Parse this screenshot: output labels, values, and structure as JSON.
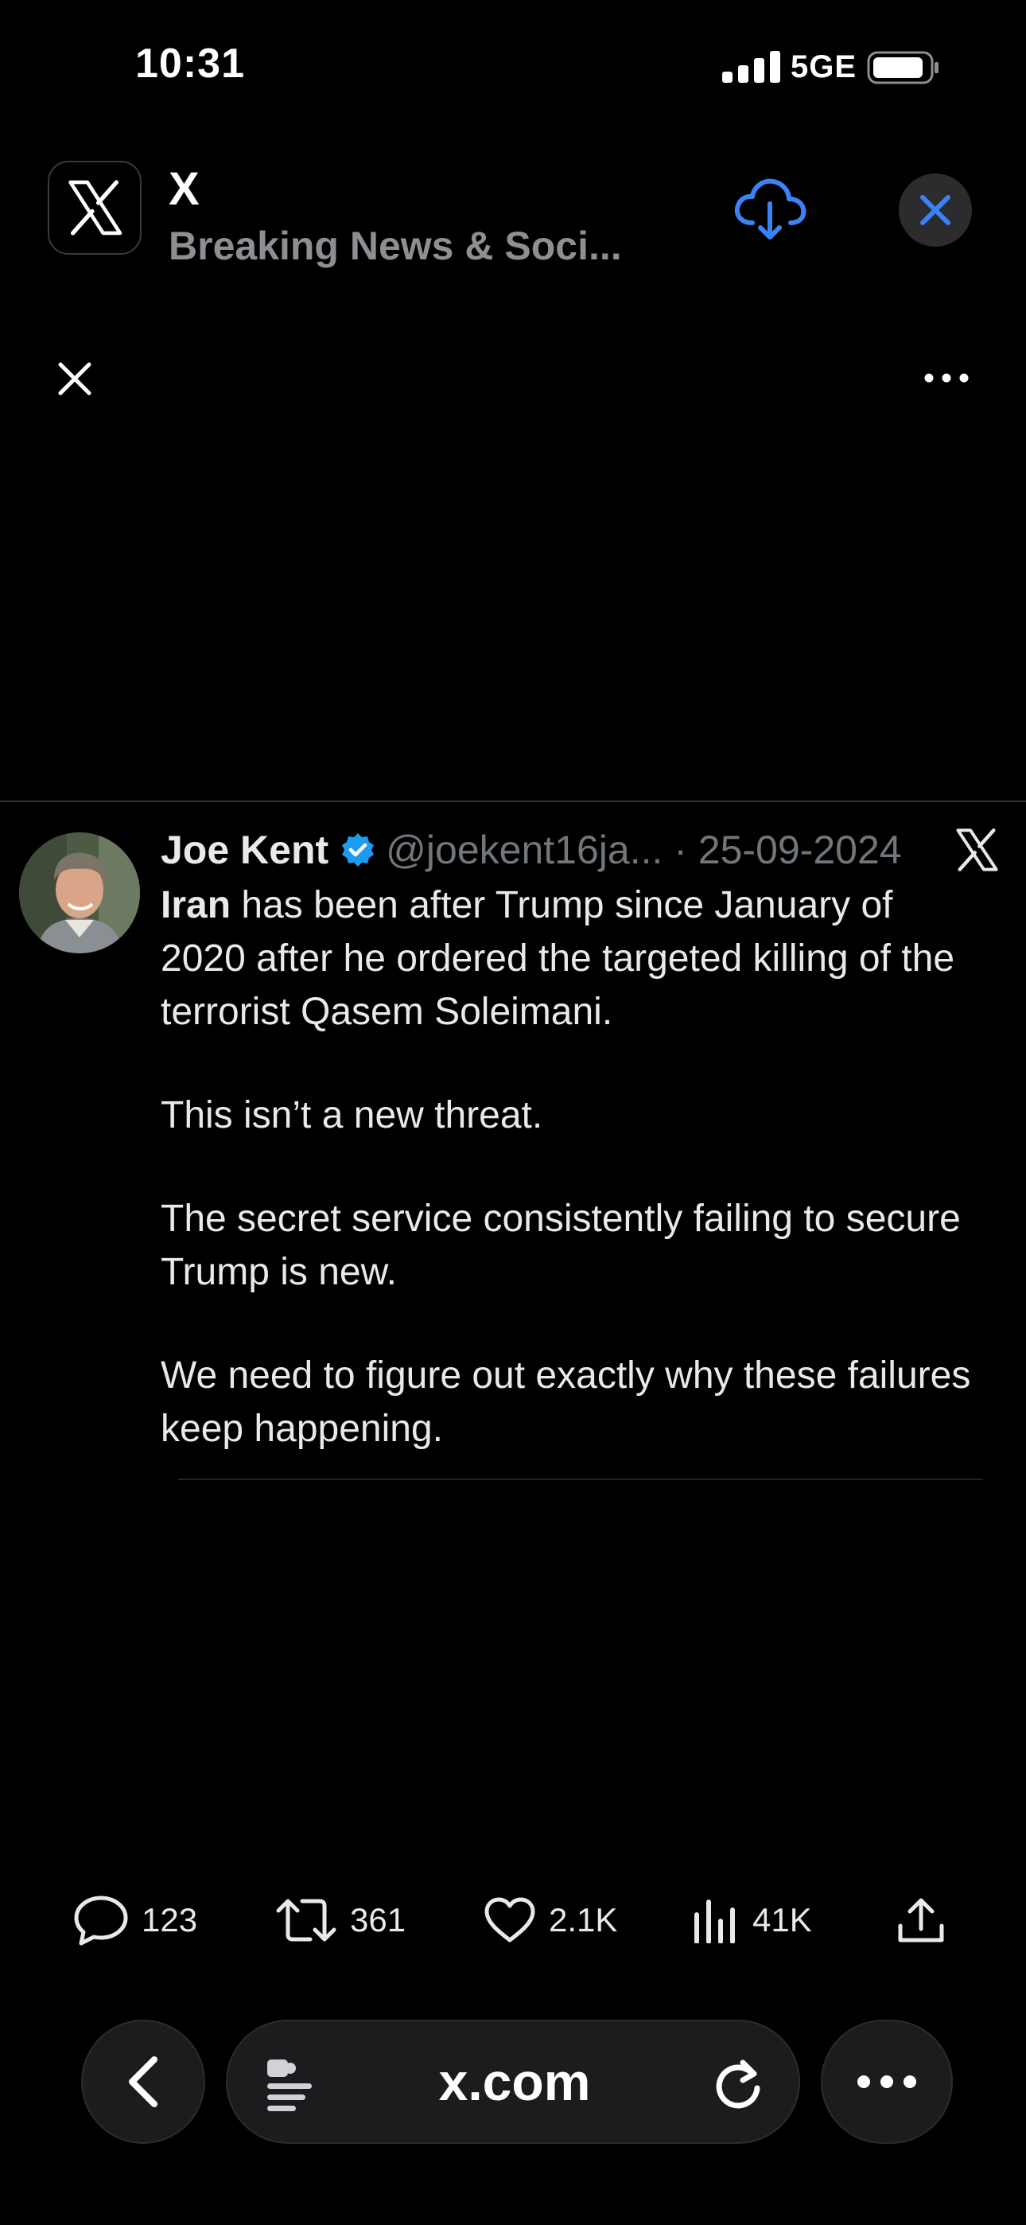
{
  "status_bar": {
    "time": "10:31",
    "network": "5GE",
    "signal_icon": "cellular-signal-icon",
    "battery_icon": "battery-icon"
  },
  "app_banner": {
    "app_name": "X",
    "subtitle": "Breaking News & Soci...",
    "icon": "x-logo-icon",
    "download_icon": "cloud-download-icon",
    "close_icon": "close-icon"
  },
  "viewer": {
    "close_icon": "close-icon",
    "more_icon": "more-horizontal-icon"
  },
  "tweet": {
    "author_name": "Joe Kent",
    "verified": true,
    "handle_date": "@joekent16ja... · 25-09-2024",
    "paragraphs": [
      {
        "bold": "Iran",
        "text": " has been after Trump since January of 2020 after he ordered the targeted killing of the terrorist Qasem Soleimani."
      },
      {
        "text": "This isn’t a new threat."
      },
      {
        "text": "The secret service consistently failing to secure Trump is new."
      },
      {
        "text": "We need to figure out exactly why these failures keep happening."
      }
    ],
    "actions": {
      "replies": "123",
      "reposts": "361",
      "likes": "2.1K",
      "views": "41K"
    }
  },
  "browser_bar": {
    "url": "x.com",
    "back_icon": "chevron-left-icon",
    "reader_icon": "reader-mode-icon",
    "reload_icon": "reload-icon",
    "menu_icon": "more-horizontal-icon"
  },
  "colors": {
    "background": "#000000",
    "accent_blue": "#3b82f6",
    "verified_blue": "#1d9bf0",
    "muted_text": "#71767b"
  }
}
